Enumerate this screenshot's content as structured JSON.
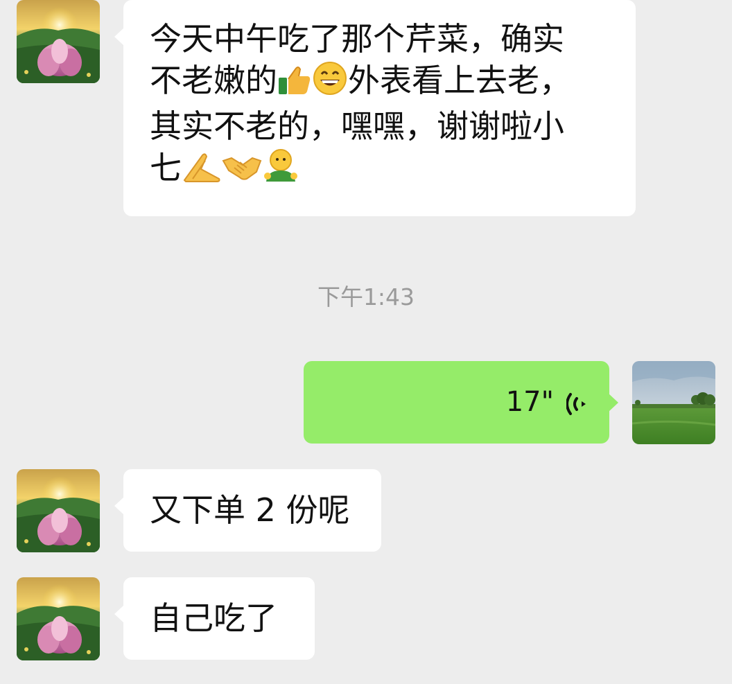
{
  "chat": {
    "timestamp": "下午1:43",
    "messages": [
      {
        "sender": "contact",
        "lines": [
          "今天中午吃了那个芹菜，确实",
          "不老嫩的",
          "外表看上去老，",
          "其实不老的，嘿嘿，谢谢啦小",
          "七"
        ],
        "emoji": [
          "thumbs-up",
          "grinning-face",
          "folded-hands",
          "handshake",
          "smile-person"
        ]
      },
      {
        "sender": "me",
        "type": "voice",
        "duration": "17\""
      },
      {
        "sender": "contact",
        "text": "又下单 2 份呢"
      },
      {
        "sender": "contact",
        "text": "自己吃了"
      }
    ]
  },
  "avatars": {
    "contact": "lotus-sunrise-avatar",
    "me": "green-field-avatar"
  },
  "colors": {
    "background": "#ededed",
    "incoming_bubble": "#ffffff",
    "outgoing_bubble": "#95ec69",
    "timestamp": "#9a9a9a"
  }
}
